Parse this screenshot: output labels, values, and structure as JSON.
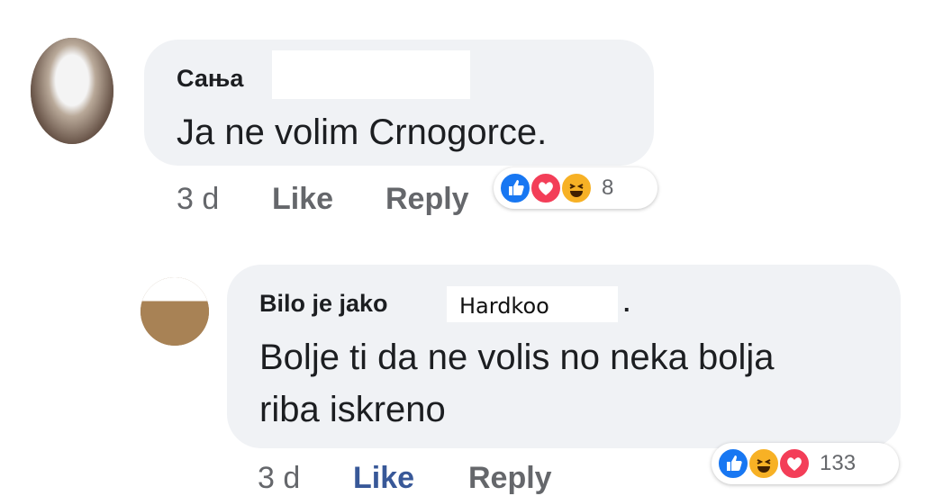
{
  "comments": [
    {
      "author": "Сања",
      "text": "Ja ne volim Crnogorce.",
      "time": "3 d",
      "like_label": "Like",
      "reply_label": "Reply",
      "reactions": [
        "like-icon",
        "love-icon",
        "haha-icon"
      ],
      "reaction_count": "8"
    },
    {
      "author": "Bilo je jako",
      "author_handwritten": "Hardkoo",
      "author_suffix": ".",
      "text_line1": "Bolje ti da ne volis no neka bolja",
      "text_line2": "riba iskreno",
      "time": "3 d",
      "like_label": "Like",
      "reply_label": "Reply",
      "reactions": [
        "like-icon",
        "haha-icon",
        "love-icon"
      ],
      "reaction_count": "133"
    }
  ],
  "colors": {
    "bubble": "#f0f2f5",
    "like_blue": "#1877f2",
    "love_red": "#f33e58",
    "haha_yellow": "#f7b125",
    "liked_text": "#385898"
  }
}
